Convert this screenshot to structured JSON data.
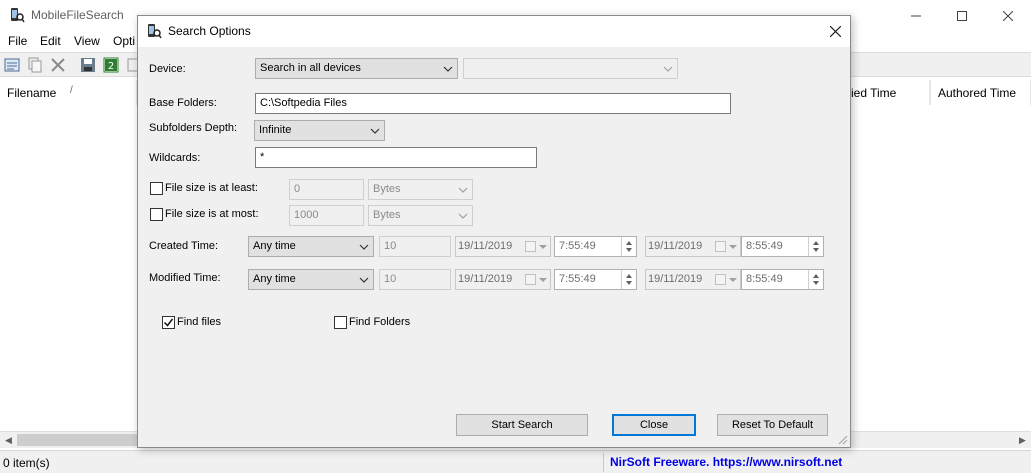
{
  "app": {
    "title": "MobileFileSearch"
  },
  "menu": [
    "File",
    "Edit",
    "View",
    "Opti"
  ],
  "columns": {
    "filename": "Filename",
    "sort_marker": "/",
    "modified_partial": "ied Time",
    "authored": "Authored Time"
  },
  "status": {
    "count": "0 item(s)",
    "link": "NirSoft Freeware. https://www.nirsoft.net"
  },
  "dialog": {
    "title": "Search Options",
    "device_label": "Device:",
    "device_value": "Search in all devices",
    "device_sub_value": "",
    "base_folders_label": "Base Folders:",
    "base_folders_value": "C:\\Softpedia Files",
    "subfolders_label": "Subfolders Depth:",
    "subfolders_value": "Infinite",
    "wildcards_label": "Wildcards:",
    "wildcards_value": "*",
    "size_least_label": "File size is at least:",
    "size_least_checked": false,
    "size_least_value": "0",
    "size_least_unit": "Bytes",
    "size_most_label": "File size is at most:",
    "size_most_checked": false,
    "size_most_value": "1000",
    "size_most_unit": "Bytes",
    "created_label": "Created Time:",
    "created_mode": "Any time",
    "created_num": "10",
    "created_from_date": "19/11/2019",
    "created_from_time": "7:55:49",
    "created_to_date": "19/11/2019",
    "created_to_time": "8:55:49",
    "modified_label": "Modified Time:",
    "modified_mode": "Any time",
    "modified_num": "10",
    "modified_from_date": "19/11/2019",
    "modified_from_time": "7:55:49",
    "modified_to_date": "19/11/2019",
    "modified_to_time": "8:55:49",
    "find_files_label": "Find files",
    "find_files_checked": true,
    "find_folders_label": "Find Folders",
    "find_folders_checked": false,
    "start_button": "Start Search",
    "close_button": "Close",
    "reset_button": "Reset To Default"
  },
  "colors": {
    "accent": "#0078d7",
    "link": "#0000e6"
  },
  "icons": [
    "app-icon",
    "minimize-icon",
    "maximize-icon",
    "close-icon",
    "properties-icon",
    "copy-icon",
    "delete-icon",
    "save-icon",
    "excel-icon",
    "dropdown-icon",
    "checkmark-icon"
  ]
}
